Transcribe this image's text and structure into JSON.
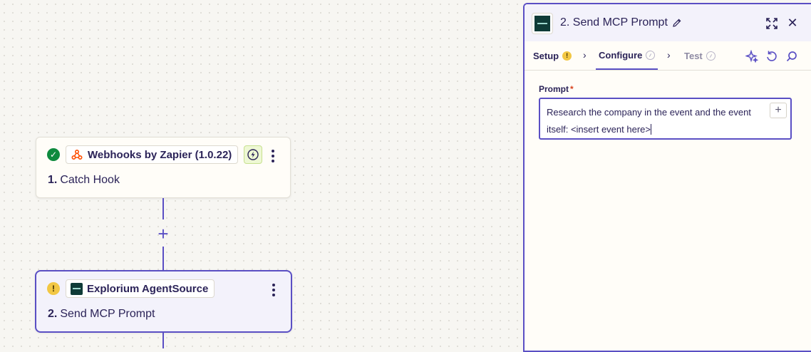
{
  "canvas": {
    "add_step_glyph": "+",
    "steps": [
      {
        "status": "complete",
        "app_name": "Webhooks by Zapier (1.0.22)",
        "number": "1.",
        "title": "Catch Hook"
      },
      {
        "status": "warning",
        "status_glyph": "!",
        "app_name": "Explorium AgentSource",
        "number": "2.",
        "title": "Send MCP Prompt"
      }
    ]
  },
  "panel": {
    "title": "2. Send MCP Prompt",
    "close_glyph": "✕",
    "tabs": [
      {
        "label": "Setup",
        "badge": "!"
      },
      {
        "label": "Configure"
      },
      {
        "label": "Test"
      }
    ],
    "chevron_glyph": "›",
    "field": {
      "label": "Prompt",
      "required_mark": "*",
      "value_line1": "Research the company in the event and the event",
      "value_line2": "itself: <insert event here>",
      "insert_glyph": "+"
    }
  },
  "colors": {
    "accent": "#5a4fc4",
    "success": "#0e8a3e",
    "warning": "#f2c744",
    "text": "#2b2358",
    "explorium_brand": "#0f3b37",
    "webhook_brand": "#ff4f00"
  },
  "icons": {
    "status_complete": "check-circle-icon",
    "status_warning": "exclamation-circle-icon",
    "webhook": "webhook-icon",
    "bolt": "lightning-bolt-icon",
    "more": "kebab-menu-icon",
    "edit": "pencil-icon",
    "expand": "expand-icon",
    "close": "close-icon",
    "ai": "sparkle-icon",
    "undo": "undo-icon",
    "search": "search-icon"
  }
}
